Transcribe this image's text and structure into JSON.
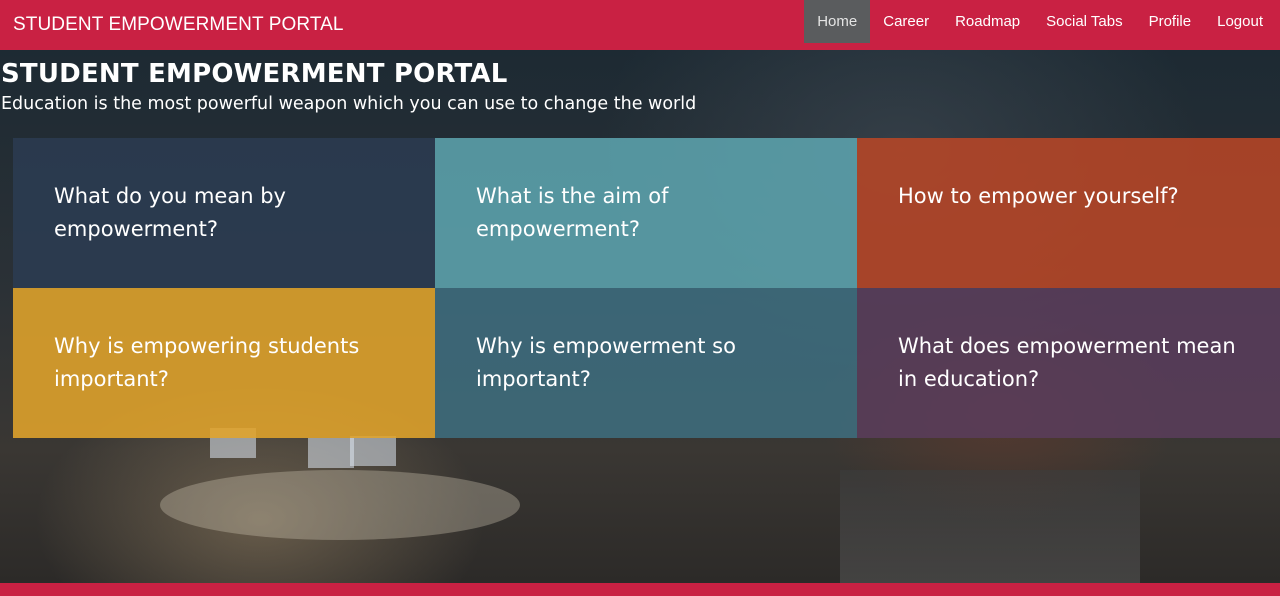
{
  "navbar": {
    "brand": "STUDENT EMPOWERMENT PORTAL",
    "links": [
      {
        "label": "Home",
        "active": true
      },
      {
        "label": "Career"
      },
      {
        "label": "Roadmap"
      },
      {
        "label": "Social Tabs"
      },
      {
        "label": "Profile"
      },
      {
        "label": "Logout"
      }
    ],
    "color": "#c92143"
  },
  "hero": {
    "title": "STUDENT EMPOWERMENT PORTAL",
    "subtitle": "Education is the most powerful weapon which you can use to change the world"
  },
  "tiles": [
    {
      "label": "What do you mean by empowerment?",
      "color": "#2c3c52"
    },
    {
      "label": "What is the aim of empowerment?",
      "color": "#5ea7b2"
    },
    {
      "label": "How to empower yourself?",
      "color": "#bc4626"
    },
    {
      "label": "Why is empowering students important?",
      "color": "#e1a42b"
    },
    {
      "label": "Why is empowerment so important?",
      "color": "#3e6e80"
    },
    {
      "label": "What does empowerment mean in education?",
      "color": "#5a3d5c"
    }
  ]
}
